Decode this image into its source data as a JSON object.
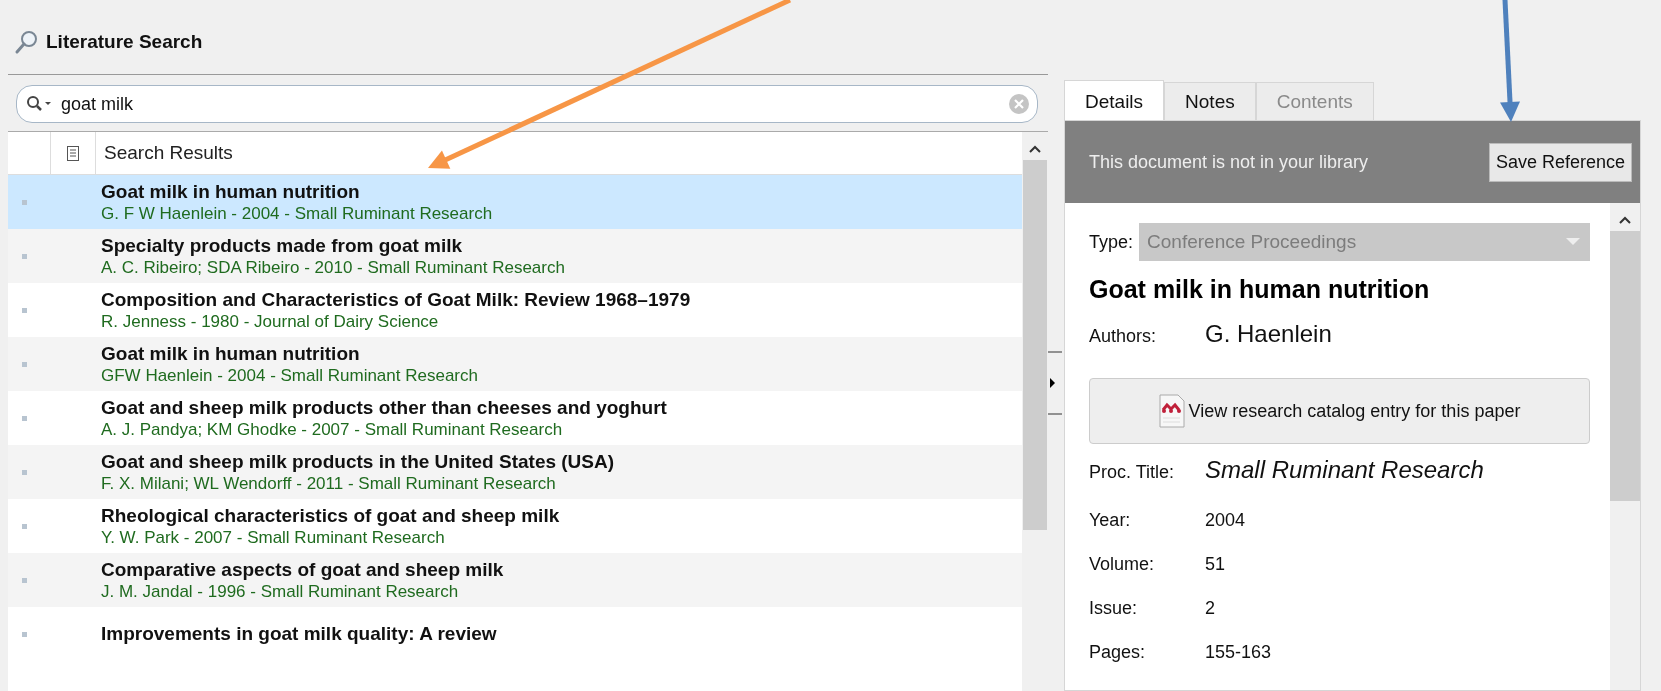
{
  "panel": {
    "title": "Literature Search"
  },
  "search": {
    "value": "goat milk"
  },
  "results": {
    "header": "Search Results",
    "rows": [
      {
        "title": "Goat milk in human nutrition",
        "meta": "G. F W Haenlein - 2004 - Small Ruminant Research",
        "selected": true
      },
      {
        "title": "Specialty products made from goat milk",
        "meta": "A. C. Ribeiro; SDA Ribeiro - 2010 - Small Ruminant Research",
        "selected": false
      },
      {
        "title": "Composition and Characteristics of Goat Milk: Review 1968–1979",
        "meta": "R. Jenness - 1980 - Journal of Dairy Science",
        "selected": false
      },
      {
        "title": "Goat milk in human nutrition",
        "meta": "GFW Haenlein - 2004 - Small Ruminant Research",
        "selected": false
      },
      {
        "title": "Goat and sheep milk products other than cheeses and yoghurt",
        "meta": "A. J. Pandya; KM Ghodke - 2007 - Small Ruminant Research",
        "selected": false
      },
      {
        "title": "Goat and sheep milk products in the United States (USA)",
        "meta": "F. X. Milani; WL Wendorff - 2011 - Small Ruminant Research",
        "selected": false
      },
      {
        "title": "Rheological characteristics of goat and sheep milk",
        "meta": "Y. W. Park - 2007 - Small Ruminant Research",
        "selected": false
      },
      {
        "title": "Comparative aspects of goat and sheep milk",
        "meta": "J. M. Jandal - 1996 - Small Ruminant Research",
        "selected": false
      },
      {
        "title": "Improvements in goat milk quality: A review",
        "selected": false
      }
    ]
  },
  "details": {
    "tabs": [
      {
        "label": "Details",
        "selected": true,
        "disabled": false
      },
      {
        "label": "Notes",
        "selected": false,
        "disabled": false
      },
      {
        "label": "Contents",
        "selected": false,
        "disabled": true
      }
    ],
    "banner": {
      "message": "This document is not in your library",
      "button": "Save Reference"
    },
    "type": {
      "label": "Type:",
      "value": "Conference Proceedings"
    },
    "title": "Goat milk in human nutrition",
    "catalog_button": "View research catalog entry for this paper",
    "fields": [
      {
        "label": "Authors:",
        "value": "G. Haenlein",
        "kind": "large"
      },
      {
        "kind": "catalog"
      },
      {
        "label": "Proc. Title:",
        "value": "Small Ruminant Research",
        "kind": "italic"
      },
      {
        "label": "Year:",
        "value": "2004",
        "kind": "plain"
      },
      {
        "label": "Volume:",
        "value": "51",
        "kind": "plain"
      },
      {
        "label": "Issue:",
        "value": "2",
        "kind": "plain"
      },
      {
        "label": "Pages:",
        "value": "155-163",
        "kind": "plain"
      }
    ]
  },
  "annotation_arrows": [
    {
      "color": "#f79646"
    },
    {
      "color": "#4f81bd"
    }
  ]
}
